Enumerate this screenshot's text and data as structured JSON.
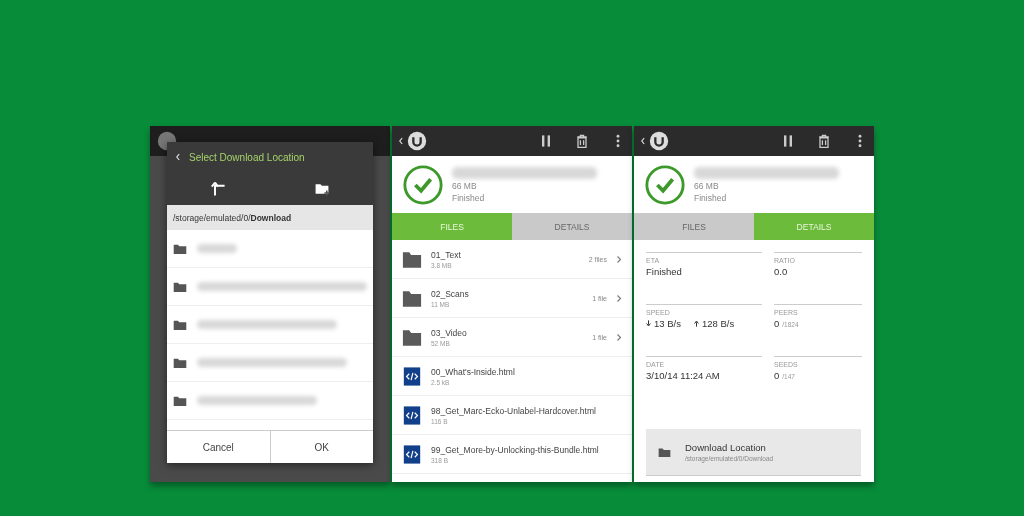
{
  "location_dialog": {
    "title": "Select Download Location",
    "path": "/storage/emulated/0/**Download**",
    "buttons": [
      "Cancel",
      "OK"
    ]
  },
  "files_screen": {
    "size": "66 MB",
    "status": "Finished",
    "tabs": [
      {
        "label": "FILES",
        "selected": true
      },
      {
        "label": "DETAILS",
        "selected": false
      }
    ],
    "files": [
      {
        "kind": "folder",
        "name": "01_Text",
        "size": "3.8 MB",
        "count": "2 files"
      },
      {
        "kind": "folder",
        "name": "02_Scans",
        "size": "11 MB",
        "count": "1 file"
      },
      {
        "kind": "folder",
        "name": "03_Video",
        "size": "52 MB",
        "count": "1 file"
      },
      {
        "kind": "html",
        "name": "00_What's-Inside.html",
        "size": "2.5 kB"
      },
      {
        "kind": "html",
        "name": "98_Get_Marc-Ecko-Unlabel-Hardcover.html",
        "size": "116 B"
      },
      {
        "kind": "html",
        "name": "99_Get_More-by-Unlocking-this-Bundle.html",
        "size": "318 B"
      }
    ]
  },
  "details_screen": {
    "size": "66 MB",
    "status": "Finished",
    "tabs": [
      {
        "label": "FILES",
        "selected": false
      },
      {
        "label": "DETAILS",
        "selected": true
      }
    ],
    "stats": [
      {
        "kind": "plain",
        "label": "ETA",
        "value": "Finished"
      },
      {
        "kind": "plain",
        "label": "RATIO",
        "value": "0.0"
      },
      {
        "kind": "speed",
        "label": "SPEED",
        "down": "13 B/s",
        "up": "128 B/s"
      },
      {
        "kind": "count",
        "label": "PEERS",
        "value": "0",
        "total": "/1824"
      },
      {
        "kind": "plain",
        "label": "DATE",
        "value": "3/10/14 11:24 AM"
      },
      {
        "kind": "count",
        "label": "SEEDS",
        "value": "0",
        "total": "/147"
      }
    ],
    "location": {
      "title": "Download Location",
      "path": "/storage/emulated/0/Download"
    }
  }
}
